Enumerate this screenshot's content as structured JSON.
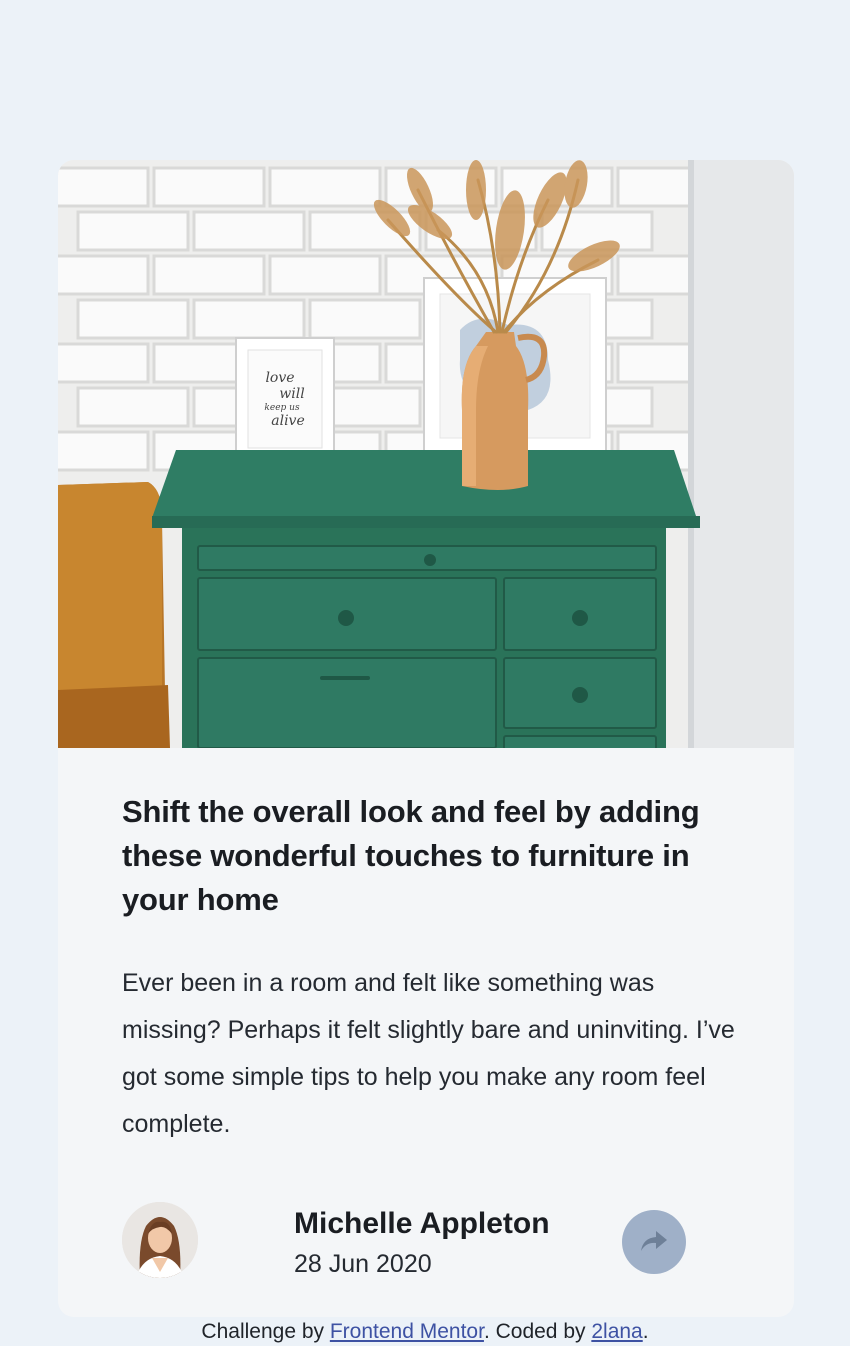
{
  "article": {
    "title": "Shift the overall look and feel by adding these wonderful touches to furniture in your home",
    "description": "Ever been in a room and felt like something was missing? Perhaps it felt slightly bare and uninviting. I’ve got some simple tips to help you make any room feel complete.",
    "frame_text": "love will keep us alive"
  },
  "author": {
    "name": "Michelle Appleton",
    "date": "28 Jun 2020"
  },
  "share": {
    "icon": "share-icon"
  },
  "attribution": {
    "prefix": "Challenge by ",
    "link1": "Frontend Mentor",
    "middle": ". Coded by ",
    "link2": "2lana",
    "suffix": "."
  },
  "colors": {
    "background": "#ecf2f8",
    "card": "#f4f6f8",
    "share_button": "#9fb0c8",
    "link": "#3e52a3",
    "dresser": "#2f7a63"
  }
}
